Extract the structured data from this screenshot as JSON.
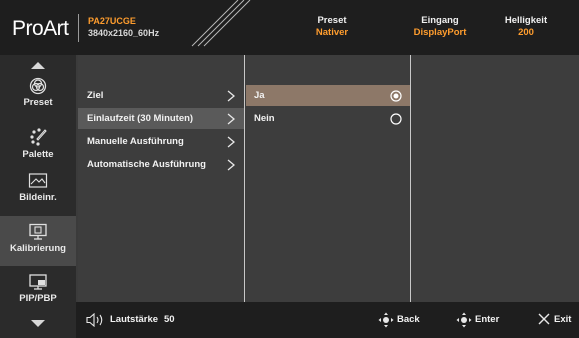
{
  "header": {
    "logo": "ProArt",
    "model": "PA27UCGE",
    "resolution": "3840x2160_60Hz",
    "preset_label": "Preset",
    "preset_value": "Nativer",
    "input_label": "Eingang",
    "input_value": "DisplayPort",
    "brightness_label": "Helligkeit",
    "brightness_value": "200"
  },
  "sidebar": {
    "items": [
      {
        "label": "Preset",
        "icon": "preset-icon"
      },
      {
        "label": "Palette",
        "icon": "palette-icon"
      },
      {
        "label": "Bildeinr.",
        "icon": "image-icon"
      },
      {
        "label": "Kalibrierung",
        "icon": "calibration-icon"
      },
      {
        "label": "PIP/PBP",
        "icon": "pip-icon"
      }
    ],
    "active": "Kalibrierung"
  },
  "menu": {
    "items": [
      {
        "label": "Ziel"
      },
      {
        "label": "Einlaufzeit (30 Minuten)"
      },
      {
        "label": "Manuelle Ausführung"
      },
      {
        "label": "Automatische Ausführung"
      }
    ],
    "selected": "Einlaufzeit (30 Minuten)"
  },
  "options": {
    "items": [
      {
        "label": "Ja"
      },
      {
        "label": "Nein"
      }
    ],
    "selected": "Ja"
  },
  "footer": {
    "volume_label": "Lautstärke",
    "volume_value": "50",
    "back_label": "Back",
    "enter_label": "Enter",
    "exit_label": "Exit"
  },
  "colors": {
    "accent": "#ff9d2e",
    "selected_option": "#8d7868",
    "selected_menu": "#5a5a5a",
    "active_sidebar": "#4a4a4a"
  }
}
